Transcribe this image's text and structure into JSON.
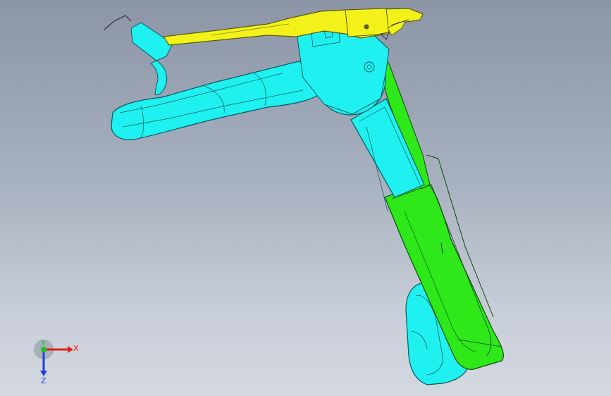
{
  "app": {
    "window": "3D CAD viewport"
  },
  "model": {
    "parts": [
      {
        "name": "upper-lever",
        "color": "#f2f21a"
      },
      {
        "name": "handle-body",
        "color": "#1ff0f0"
      },
      {
        "name": "grip-lever",
        "color": "#2ee81a"
      },
      {
        "name": "finger-guard",
        "color": "#1ff0f0"
      }
    ]
  },
  "triad": {
    "x_label": "X",
    "y_label": "Y",
    "z_label": "Z",
    "x_color": "#e0201a",
    "y_color": "#20c020",
    "z_color": "#2040e0"
  },
  "icons": [
    "coordinate-triad-icon"
  ]
}
